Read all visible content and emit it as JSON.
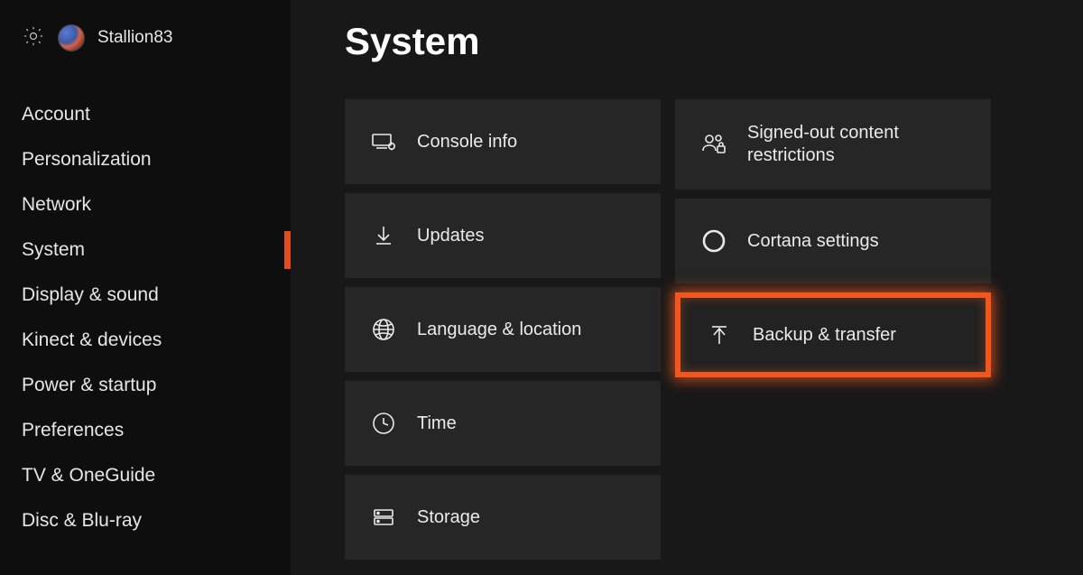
{
  "user": {
    "name": "Stallion83"
  },
  "page": {
    "title": "System"
  },
  "sidebar": {
    "items": [
      {
        "label": "Account"
      },
      {
        "label": "Personalization"
      },
      {
        "label": "Network"
      },
      {
        "label": "System"
      },
      {
        "label": "Display & sound"
      },
      {
        "label": "Kinect & devices"
      },
      {
        "label": "Power & startup"
      },
      {
        "label": "Preferences"
      },
      {
        "label": "TV & OneGuide"
      },
      {
        "label": "Disc & Blu-ray"
      }
    ],
    "active_index": 3
  },
  "tiles": {
    "col1": [
      {
        "label": "Console info",
        "icon": "monitor-gear"
      },
      {
        "label": "Updates",
        "icon": "download"
      },
      {
        "label": "Language & location",
        "icon": "globe"
      },
      {
        "label": "Time",
        "icon": "clock"
      },
      {
        "label": "Storage",
        "icon": "drive"
      }
    ],
    "col2": [
      {
        "label": "Signed-out content restrictions",
        "icon": "people-lock"
      },
      {
        "label": "Cortana settings",
        "icon": "ring"
      },
      {
        "label": "Backup & transfer",
        "icon": "upload",
        "highlight": true
      }
    ]
  }
}
